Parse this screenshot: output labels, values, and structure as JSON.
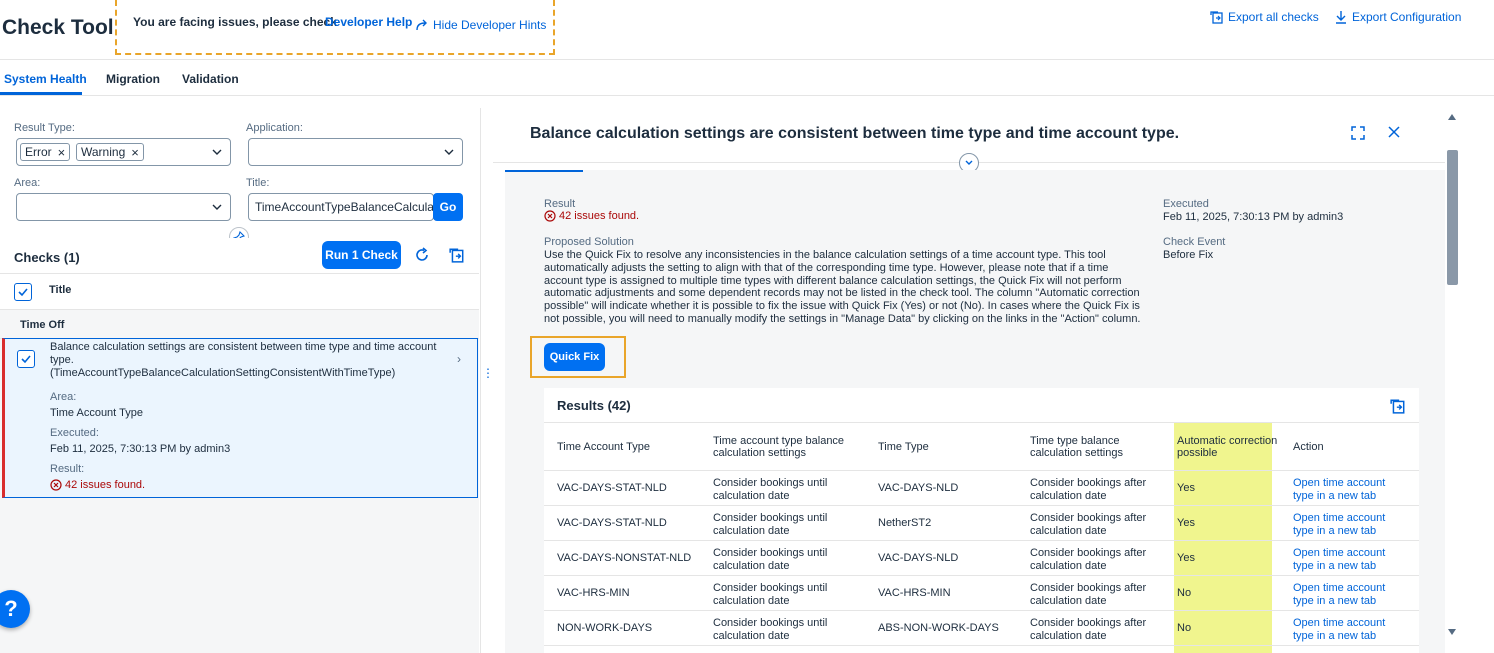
{
  "header": {
    "title": "Check Tool",
    "hint_text": "You are facing issues, please check",
    "hint_link": "Developer Help",
    "hide_hints": "Hide Developer Hints",
    "export_all": "Export all checks",
    "export_config": "Export Configuration"
  },
  "tabs": [
    "System Health",
    "Migration",
    "Validation"
  ],
  "filters": {
    "result_type_label": "Result Type:",
    "result_type_tokens": [
      "Error",
      "Warning"
    ],
    "application_label": "Application:",
    "area_label": "Area:",
    "title_label": "Title:",
    "title_value": "TimeAccountTypeBalanceCalculationSettingConsistentWithTimeType",
    "go": "Go"
  },
  "checks": {
    "title": "Checks (1)",
    "run_button": "Run 1 Check",
    "column_title": "Title",
    "group": "Time Off",
    "item": {
      "title": "Balance calculation settings are consistent between time type and time account type.",
      "title_id": "(TimeAccountTypeBalanceCalculationSettingConsistentWithTimeType)",
      "area_label": "Area:",
      "area_value": "Time Account Type",
      "executed_label": "Executed:",
      "executed_value": "Feb 11, 2025, 7:30:13 PM by admin3",
      "result_label": "Result:",
      "result_value": "42 issues found."
    }
  },
  "detail": {
    "title": "Balance calculation settings are consistent between time type and time account type.",
    "result_label": "Result",
    "result_value": "42 issues found.",
    "executed_label": "Executed",
    "executed_value": "Feb 11, 2025, 7:30:13 PM by admin3",
    "solution_label": "Proposed Solution",
    "solution_text": "Use the Quick Fix to resolve any inconsistencies in the balance calculation settings of a time account type. This tool automatically adjusts the setting to align with that of the corresponding time type. However, please note that if a time account type is assigned to multiple time types with different balance calculation settings, the Quick Fix will not perform automatic adjustments and some dependent records may not be listed in the check tool. The column \"Automatic correction possible\" will indicate whether it is possible to fix the issue with Quick Fix (Yes) or not (No). In cases where the Quick Fix is not possible, you will need to manually modify the settings in \"Manage Data\" by clicking on the links in the \"Action\" column.",
    "check_event_label": "Check Event",
    "check_event_value": "Before Fix",
    "quick_fix": "Quick Fix"
  },
  "results": {
    "title": "Results (42)",
    "columns": [
      "Time Account Type",
      "Time account type balance calculation settings",
      "Time Type",
      "Time type balance calculation settings",
      "Automatic correction possible",
      "Action"
    ],
    "rows": [
      [
        "VAC-DAYS-STAT-NLD",
        "Consider bookings until calculation date",
        "VAC-DAYS-NLD",
        "Consider bookings after calculation date",
        "Yes",
        "Open time account type in a new tab"
      ],
      [
        "VAC-DAYS-STAT-NLD",
        "Consider bookings until calculation date",
        "NetherST2",
        "Consider bookings after calculation date",
        "Yes",
        "Open time account type in a new tab"
      ],
      [
        "VAC-DAYS-NONSTAT-NLD",
        "Consider bookings until calculation date",
        "VAC-DAYS-NLD",
        "Consider bookings after calculation date",
        "Yes",
        "Open time account type in a new tab"
      ],
      [
        "VAC-HRS-MIN",
        "Consider bookings until calculation date",
        "VAC-HRS-MIN",
        "Consider bookings after calculation date",
        "No",
        "Open time account type in a new tab"
      ],
      [
        "NON-WORK-DAYS",
        "Consider bookings until calculation date",
        "ABS-NON-WORK-DAYS",
        "Consider bookings after calculation date",
        "No",
        "Open time account type in a new tab"
      ]
    ]
  },
  "help": "?"
}
